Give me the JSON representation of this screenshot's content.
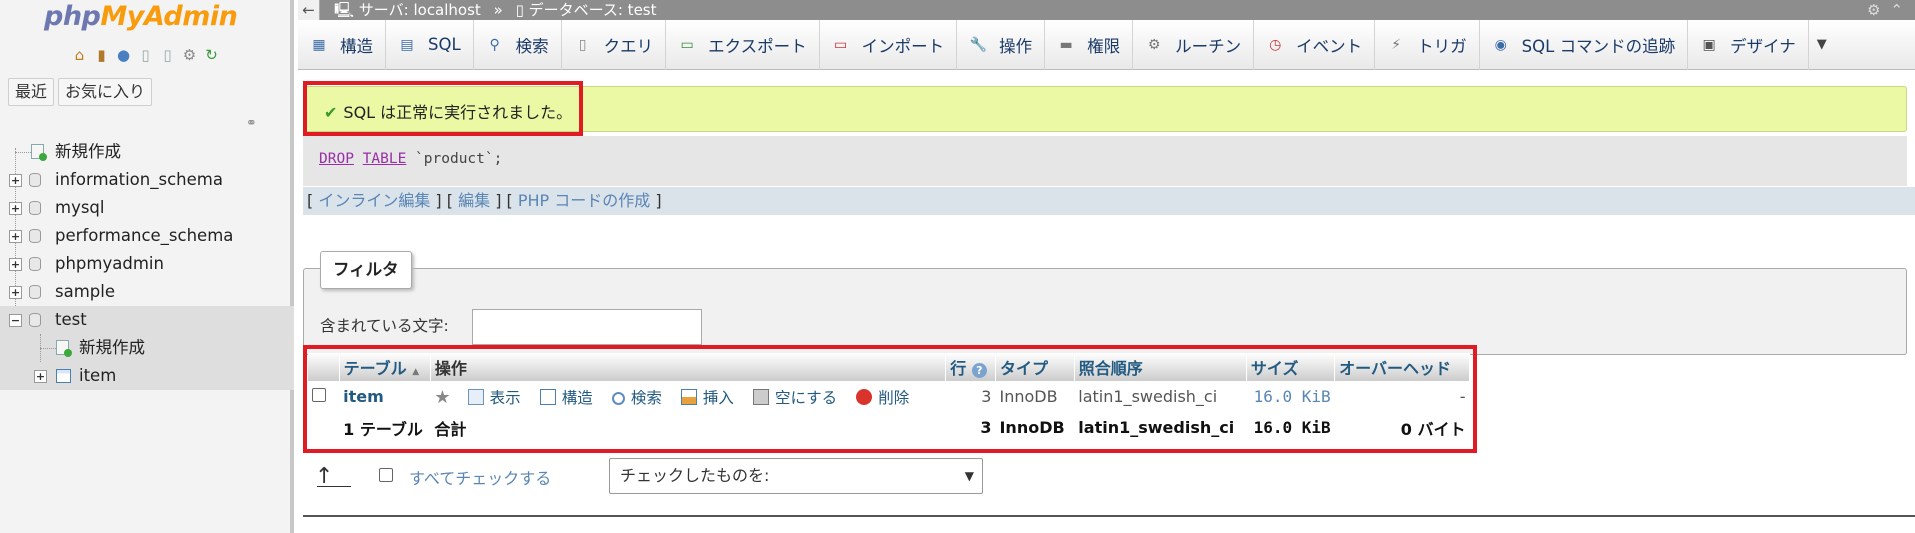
{
  "nav": {
    "logo_php": "php",
    "logo_myadmin": "MyAdmin",
    "icons": [
      "home-icon",
      "exit-icon",
      "help-icon",
      "docs-icon",
      "copy-icon",
      "settings-icon",
      "reload-icon"
    ],
    "tabs": [
      "最近",
      "お気に入り"
    ],
    "tree": [
      {
        "label": "新規作成",
        "type": "new"
      },
      {
        "label": "information_schema",
        "type": "db"
      },
      {
        "label": "mysql",
        "type": "db"
      },
      {
        "label": "performance_schema",
        "type": "db"
      },
      {
        "label": "phpmyadmin",
        "type": "db"
      },
      {
        "label": "sample",
        "type": "db"
      },
      {
        "label": "test",
        "type": "db",
        "selected": true
      },
      {
        "label": "新規作成",
        "type": "new-child"
      },
      {
        "label": "item",
        "type": "table-child"
      }
    ]
  },
  "breadcrumb": {
    "server": "サーバ: localhost",
    "sep": "»",
    "database": "データベース: test"
  },
  "topmenu": [
    {
      "label": "構造",
      "icon": "structure-icon"
    },
    {
      "label": "SQL",
      "icon": "sql-icon"
    },
    {
      "label": "検索",
      "icon": "search-icon"
    },
    {
      "label": "クエリ",
      "icon": "query-icon"
    },
    {
      "label": "エクスポート",
      "icon": "export-icon"
    },
    {
      "label": "インポート",
      "icon": "import-icon"
    },
    {
      "label": "操作",
      "icon": "wrench-icon"
    },
    {
      "label": "権限",
      "icon": "privileges-icon"
    },
    {
      "label": "ルーチン",
      "icon": "routines-icon"
    },
    {
      "label": "イベント",
      "icon": "events-icon"
    },
    {
      "label": "トリガ",
      "icon": "triggers-icon"
    },
    {
      "label": "SQL コマンドの追跡",
      "icon": "eye-icon"
    },
    {
      "label": "デザイナ",
      "icon": "designer-icon"
    }
  ],
  "message": {
    "text": "SQL は正常に実行されました。"
  },
  "sql": {
    "kw1": "DROP",
    "kw2": "TABLE",
    "rest": " `product`;"
  },
  "actions": {
    "inline_edit": "インライン編集",
    "edit": "編集",
    "create_php": "PHP コードの作成"
  },
  "filter": {
    "legend": "フィルタ",
    "label": "含まれている文字:",
    "value": ""
  },
  "table": {
    "headers": {
      "table": "テーブル",
      "sort": "▲",
      "action": "操作",
      "rows": "行",
      "type": "タイプ",
      "collation": "照合順序",
      "size": "サイズ",
      "overhead": "オーバーヘッド"
    },
    "row": {
      "name": "item",
      "actions": {
        "browse": "表示",
        "structure": "構造",
        "search": "検索",
        "insert": "挿入",
        "empty": "空にする",
        "drop": "削除"
      },
      "rows": "3",
      "type": "InnoDB",
      "collation": "latin1_swedish_ci",
      "size": "16.0 KiB",
      "overhead": "-"
    },
    "total": {
      "name": "1 テーブル",
      "action": "合計",
      "rows": "3",
      "type": "InnoDB",
      "collation": "latin1_swedish_ci",
      "size": "16.0 KiB",
      "overhead": "0 バイト"
    }
  },
  "bottom": {
    "check_all": "すべてチェックする",
    "with_selected": "チェックしたものを:"
  }
}
